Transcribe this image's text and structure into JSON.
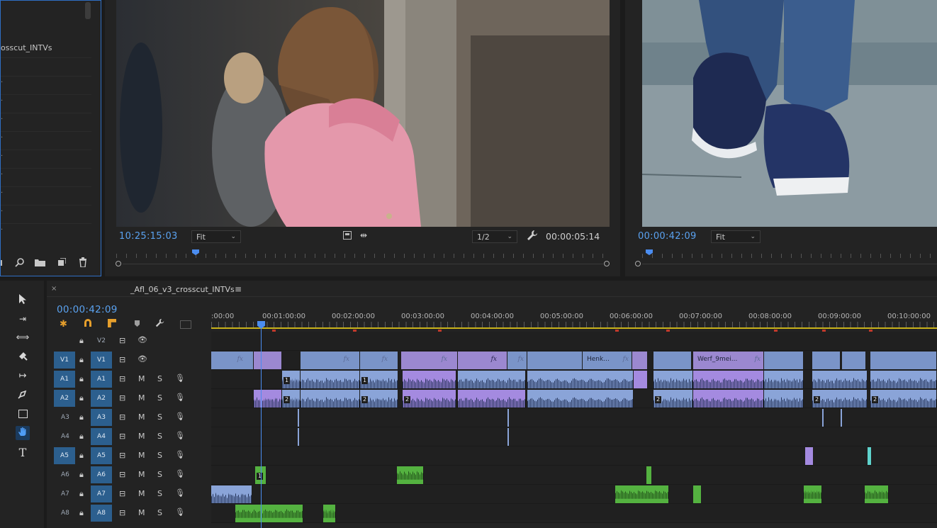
{
  "project_panel": {
    "item_name": "osscut_INTVs",
    "row_marks": [
      "·",
      "·",
      "·",
      "·",
      "·",
      "·",
      "·",
      "·",
      "·",
      "·",
      "·"
    ],
    "footer_icons": [
      "search-icon",
      "folder-icon",
      "new-item-icon",
      "trash-icon"
    ]
  },
  "source_monitor": {
    "timecode": "10:25:15:03",
    "fit_label": "Fit",
    "resolution_label": "1/2",
    "duration": "00:00:05:14"
  },
  "program_monitor": {
    "timecode": "00:00:42:09",
    "fit_label": "Fit"
  },
  "timeline": {
    "sequence_name": "_Afl_06_v3_crosscut_INTVs",
    "menu_glyph": "≡",
    "close_glyph": "×",
    "timecode": "00:00:42:09",
    "ruler": [
      ":00:00",
      "00:01:00:00",
      "00:02:00:00",
      "00:03:00:00",
      "00:04:00:00",
      "00:05:00:00",
      "00:06:00:00",
      "00:07:00:00",
      "00:08:00:00",
      "00:09:00:00",
      "00:10:00:00"
    ],
    "tracks": [
      {
        "src": "",
        "tgt": "V2",
        "type": "video"
      },
      {
        "src": "V1",
        "tgt": "V1",
        "type": "video"
      },
      {
        "src": "A1",
        "tgt": "A1",
        "type": "audio"
      },
      {
        "src": "A2",
        "tgt": "A2",
        "type": "audio"
      },
      {
        "src": "A3",
        "tgt": "A3",
        "type": "audio"
      },
      {
        "src": "A4",
        "tgt": "A4",
        "type": "audio"
      },
      {
        "src": "A5",
        "tgt": "A5",
        "type": "audio"
      },
      {
        "src": "A6",
        "tgt": "A6",
        "type": "audio"
      },
      {
        "src": "A7",
        "tgt": "A7",
        "type": "audio"
      },
      {
        "src": "A8",
        "tgt": "A8",
        "type": "audio"
      }
    ],
    "mute_label": "M",
    "solo_label": "S",
    "clip_names": {
      "henk": "Henk...",
      "werf": "Werf_9mei..."
    },
    "fx_label": "fx",
    "channel_1": "1",
    "channel_2": "2"
  },
  "colors": {
    "accent": "#5aa2f0",
    "video_clip": "#7a94c8",
    "purple_clip": "#9b88d0",
    "green_clip": "#54b240",
    "teal_clip": "#5fd3cd",
    "track_target": "#2c5f8e",
    "marker": "#c0392b"
  }
}
